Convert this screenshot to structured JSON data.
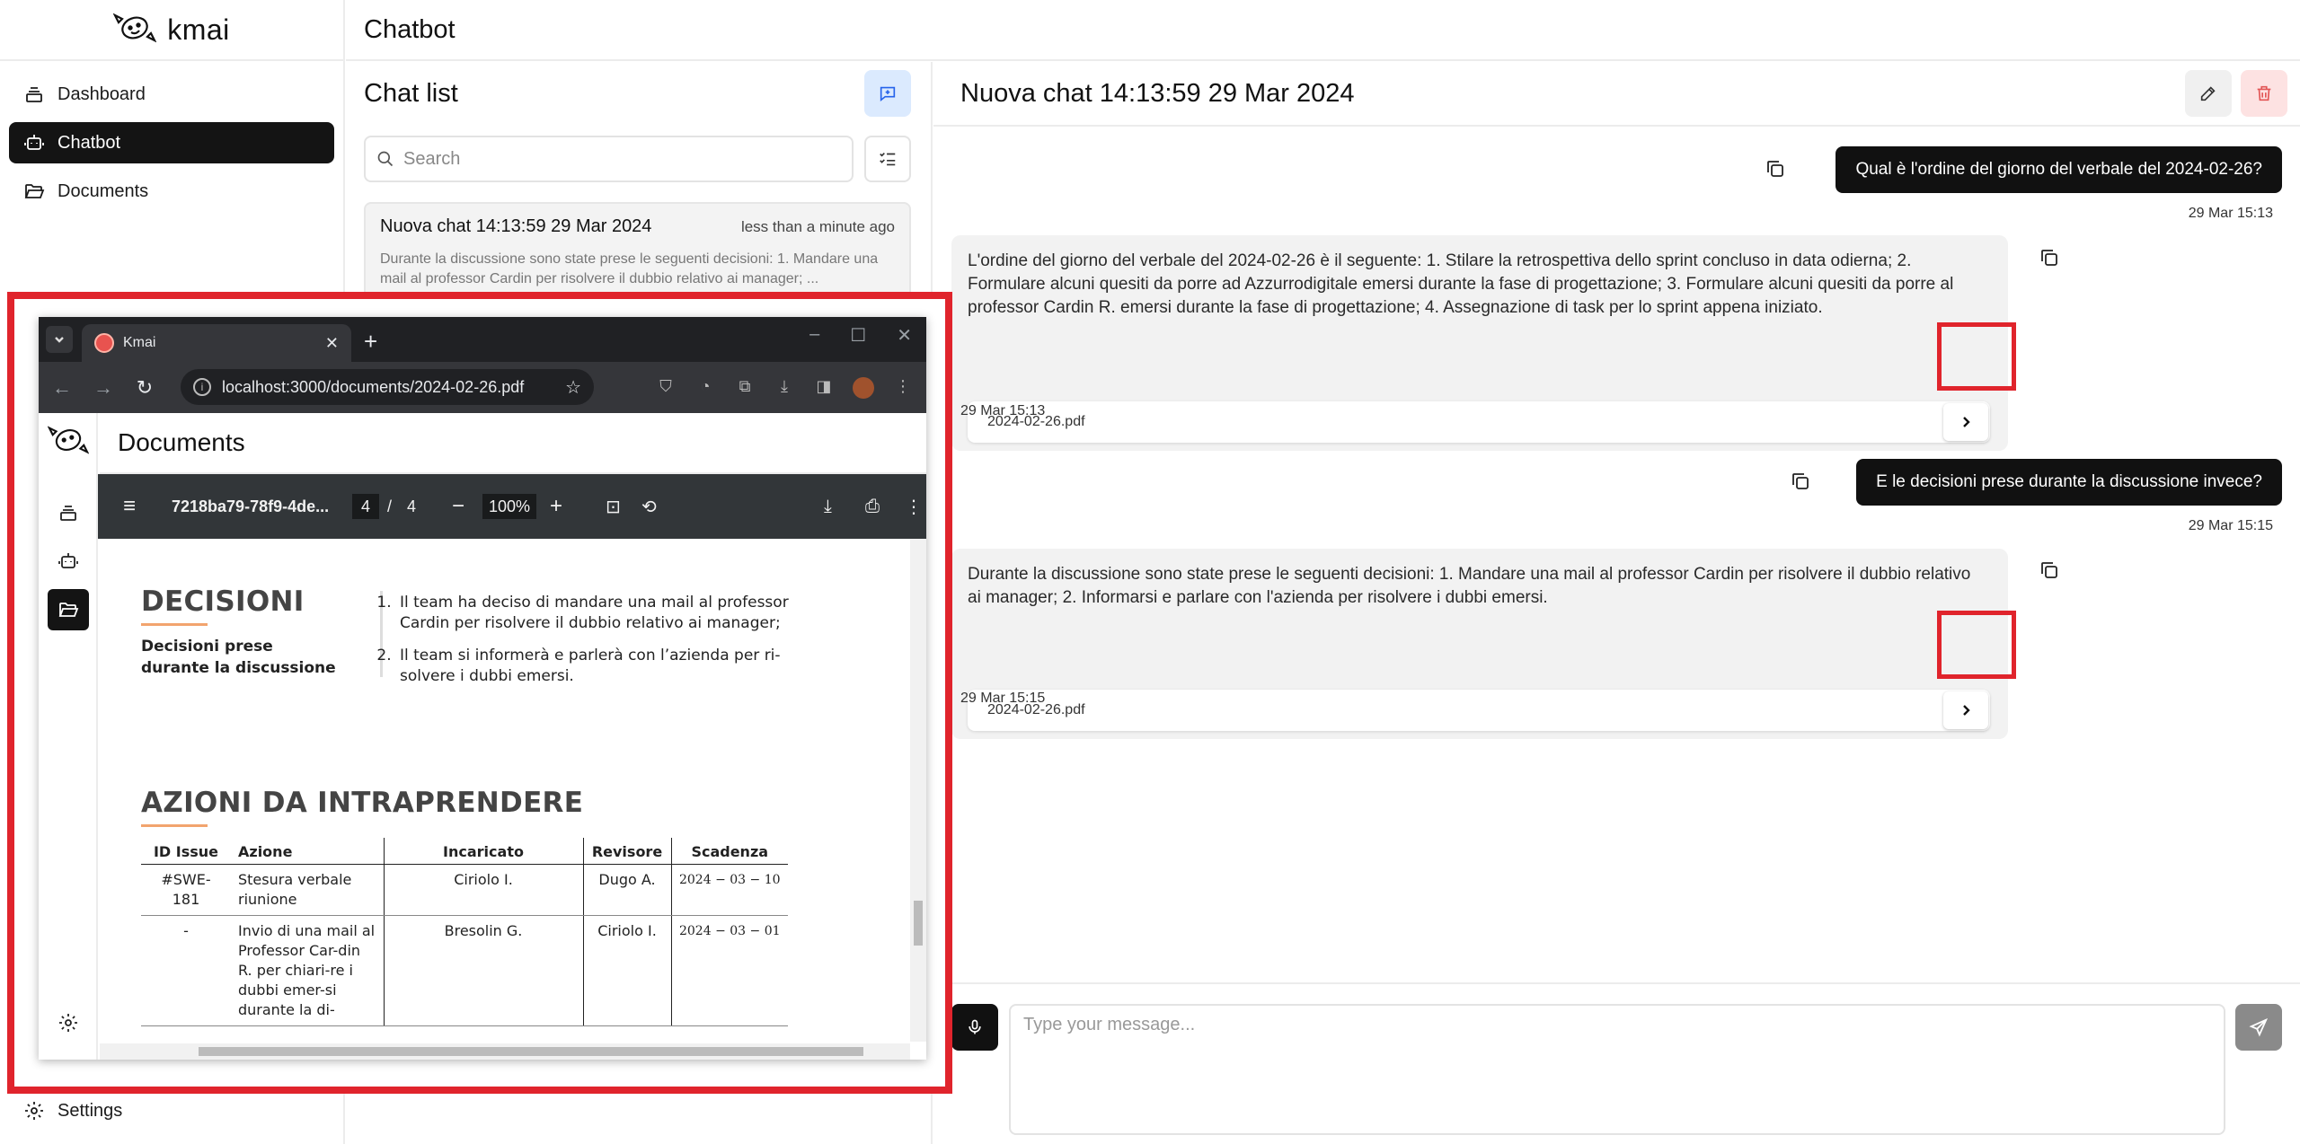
{
  "brand": {
    "name": "kmai"
  },
  "sidebar": {
    "items": [
      {
        "label": "Dashboard",
        "icon": "stack-icon"
      },
      {
        "label": "Chatbot",
        "icon": "bot-icon",
        "active": true
      },
      {
        "label": "Documents",
        "icon": "folder-icon"
      }
    ],
    "settings_label": "Settings"
  },
  "header": {
    "title": "Chatbot"
  },
  "chat_list": {
    "title": "Chat list",
    "search_placeholder": "Search",
    "chats": [
      {
        "title": "Nuova chat 14:13:59 29 Mar 2024",
        "time": "less than a minute ago",
        "preview": "Durante la discussione sono state prese le seguenti decisioni: 1. Mandare una mail al professor Cardin per risolvere il dubbio relativo ai manager; ..."
      }
    ]
  },
  "conversation": {
    "title": "Nuova chat 14:13:59 29 Mar 2024",
    "messages": [
      {
        "role": "user",
        "text": "Qual è l'ordine del giorno del verbale del 2024-02-26?",
        "time": "29 Mar 15:13"
      },
      {
        "role": "bot",
        "text": "L'ordine del giorno del verbale del 2024-02-26 è il seguente: 1. Stilare la retrospettiva dello sprint concluso in data odierna; 2. Formulare alcuni quesiti da porre ad Azzurrodigitale emersi durante la fase di progettazione; 3. Formulare alcuni quesiti da porre al professor Cardin R. emersi durante la fase di progettazione; 4. Assegnazione di task per lo sprint appena iniziato.",
        "document": "2024-02-26.pdf",
        "time": "29 Mar 15:13"
      },
      {
        "role": "user",
        "text": "E le decisioni prese durante la discussione invece?",
        "time": "29 Mar 15:15"
      },
      {
        "role": "bot",
        "text": "Durante la discussione sono state prese le seguenti decisioni: 1. Mandare una mail al professor Cardin per risolvere il dubbio relativo ai manager; 2. Informarsi e parlare con l'azienda per risolvere i dubbi emersi.",
        "document": "2024-02-26.pdf",
        "time": "29 Mar 15:15"
      }
    ],
    "composer_placeholder": "Type your message..."
  },
  "browser": {
    "tab_title": "Kmai",
    "url": "localhost:3000/documents/2024-02-26.pdf",
    "app_header": "Documents",
    "pdf": {
      "name": "7218ba79-78f9-4de...",
      "page": "4",
      "page_separator": "/",
      "total_pages": "4",
      "zoom": "100%",
      "decisions_title": "DECISIONI",
      "decisions_subtitle": "Decisioni prese durante la discussione",
      "decisions": [
        "Il team ha deciso di mandare una mail al professor Cardin per risolvere il dubbio relativo ai manager;",
        "Il team si informerà e parlerà con l’azienda per ri-solvere i dubbi emersi."
      ],
      "actions_title": "AZIONI DA INTRAPRENDERE",
      "table": {
        "headers": [
          "ID Issue",
          "Azione",
          "Incaricato",
          "Revisore",
          "Scadenza"
        ],
        "rows": [
          [
            "#SWE-181",
            "Stesura verbale riunione",
            "Ciriolo I.",
            "Dugo A.",
            "2024 − 03 − 10"
          ],
          [
            "-",
            "Invio di una mail al Professor Car-din R. per chiari-re i dubbi emer-si durante la di-",
            "Bresolin G.",
            "Ciriolo I.",
            "2024 − 03 − 01"
          ]
        ]
      }
    }
  },
  "colors": {
    "highlight": "#e0242c",
    "accent_orange": "#f2a46e",
    "new_chat_bg": "#dbeafe",
    "delete_bg": "#fde2e2"
  }
}
